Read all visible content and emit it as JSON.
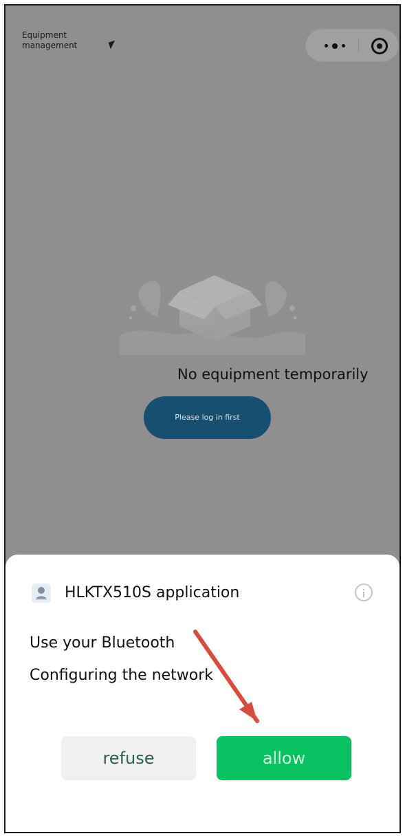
{
  "header": {
    "title": "Equipment management"
  },
  "main": {
    "empty_state_text": "No equipment temporarily",
    "login_button": "Please log in first"
  },
  "permission_sheet": {
    "app_name": "HLKTX510S application",
    "permissions": [
      "Use your Bluetooth",
      "Configuring the network"
    ],
    "refuse_label": "refuse",
    "allow_label": "allow"
  },
  "colors": {
    "overlay_gray": "#8f8f8f",
    "login_blue": "#164f70",
    "allow_green": "#08c160",
    "arrow_red": "#d94b3f"
  },
  "icons": {
    "menu_capsule_more": "more-icon",
    "menu_capsule_close": "target-icon",
    "sheet_info": "info-icon",
    "app_avatar": "app-avatar-icon"
  }
}
